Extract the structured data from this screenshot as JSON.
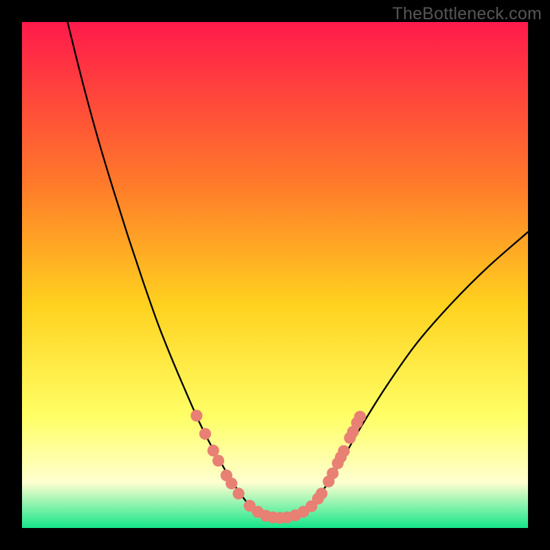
{
  "watermark": "TheBottleneck.com",
  "colors": {
    "gradient_top": "#ff1a4b",
    "gradient_mid1": "#ff7a2a",
    "gradient_mid2": "#ffd21f",
    "gradient_mid3": "#ffff66",
    "gradient_mid4": "#ffffd0",
    "gradient_bottom": "#15e68a",
    "curve": "#000000",
    "marker_fill": "#e88074",
    "marker_stroke": "#c05b50"
  },
  "chart_data": {
    "type": "line",
    "title": "",
    "xlabel": "",
    "ylabel": "",
    "xlim": [
      0,
      100
    ],
    "ylim": [
      0,
      100
    ],
    "series": [
      {
        "name": "left-branch",
        "x": [
          9,
          12,
          15,
          18,
          21,
          24,
          27,
          30,
          33,
          35,
          37,
          39,
          41,
          43,
          44.5,
          46
        ],
        "y": [
          100,
          88,
          77,
          67,
          57.5,
          48.5,
          40,
          32.5,
          25.5,
          21,
          17,
          13.5,
          10,
          7,
          5,
          3.4
        ]
      },
      {
        "name": "valley-floor",
        "x": [
          46,
          48,
          50,
          52,
          54,
          56
        ],
        "y": [
          3.4,
          2.4,
          2.0,
          2.0,
          2.4,
          3.4
        ]
      },
      {
        "name": "right-branch",
        "x": [
          56,
          58,
          60,
          63,
          67,
          72,
          78,
          85,
          92,
          100
        ],
        "y": [
          3.4,
          5.5,
          8.2,
          13,
          20,
          28,
          36.5,
          44.5,
          51.5,
          58.5
        ]
      }
    ],
    "markers": [
      {
        "x": 34.5,
        "y": 22.2
      },
      {
        "x": 36.2,
        "y": 18.6
      },
      {
        "x": 37.8,
        "y": 15.3
      },
      {
        "x": 38.8,
        "y": 13.3
      },
      {
        "x": 40.4,
        "y": 10.4
      },
      {
        "x": 41.4,
        "y": 8.8
      },
      {
        "x": 42.8,
        "y": 6.8
      },
      {
        "x": 45.0,
        "y": 4.4
      },
      {
        "x": 46.6,
        "y": 3.2
      },
      {
        "x": 48.2,
        "y": 2.4
      },
      {
        "x": 49.6,
        "y": 2.1
      },
      {
        "x": 51.0,
        "y": 2.0
      },
      {
        "x": 52.4,
        "y": 2.1
      },
      {
        "x": 54.0,
        "y": 2.5
      },
      {
        "x": 55.6,
        "y": 3.2
      },
      {
        "x": 57.2,
        "y": 4.3
      },
      {
        "x": 58.5,
        "y": 5.8
      },
      {
        "x": 59.2,
        "y": 6.8
      },
      {
        "x": 60.6,
        "y": 9.2
      },
      {
        "x": 61.4,
        "y": 10.8
      },
      {
        "x": 62.4,
        "y": 12.8
      },
      {
        "x": 63.0,
        "y": 14.0
      },
      {
        "x": 63.6,
        "y": 15.2
      },
      {
        "x": 64.8,
        "y": 17.8
      },
      {
        "x": 65.4,
        "y": 19.0
      },
      {
        "x": 66.2,
        "y": 20.8
      },
      {
        "x": 66.8,
        "y": 22.0
      }
    ]
  }
}
